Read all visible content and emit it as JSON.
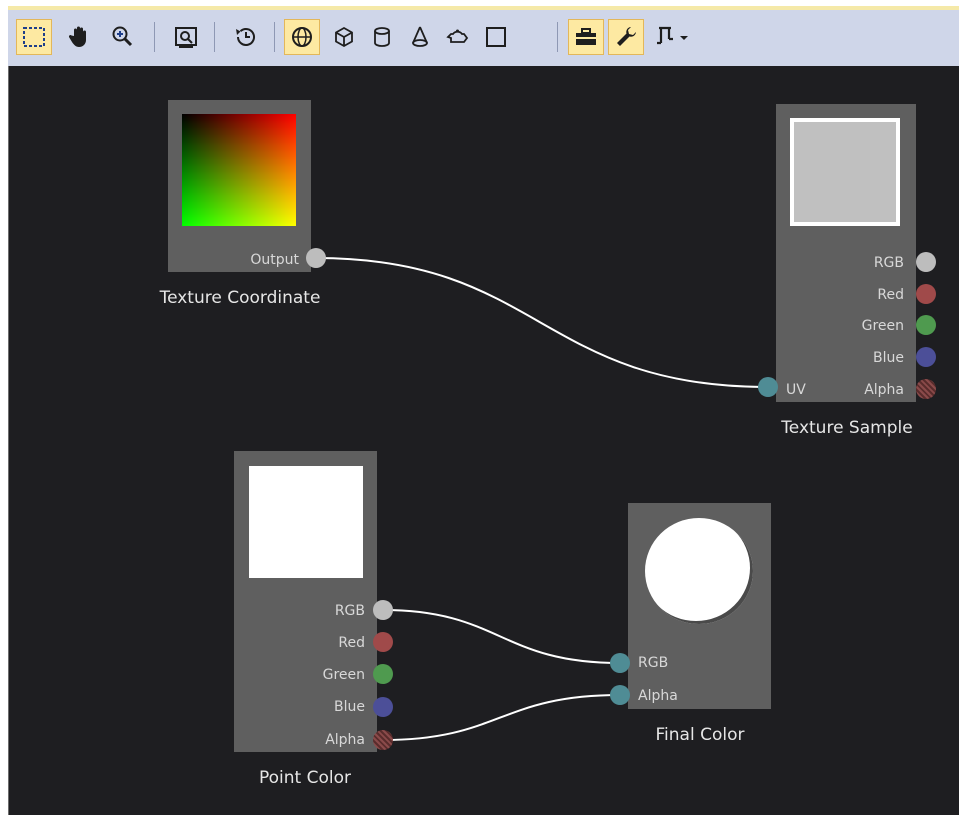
{
  "toolbar": {
    "buttons": [
      {
        "name": "select-tool-button",
        "icon": "dashed-rectangle-icon",
        "active": true
      },
      {
        "name": "pan-tool-button",
        "icon": "hand-icon",
        "active": false
      },
      {
        "name": "zoom-tool-button",
        "icon": "magnifier-plus-icon",
        "active": false
      },
      {
        "name": "zoom-to-fit-button",
        "icon": "zoom-fit-icon",
        "active": false
      },
      {
        "name": "real-time-mode-button",
        "icon": "clock-refresh-icon",
        "active": false
      },
      {
        "name": "sphere-preview-button",
        "icon": "sphere-icon",
        "active": true
      },
      {
        "name": "cube-preview-button",
        "icon": "cube-icon",
        "active": false
      },
      {
        "name": "cylinder-preview-button",
        "icon": "cylinder-icon",
        "active": false
      },
      {
        "name": "cone-preview-button",
        "icon": "cone-icon",
        "active": false
      },
      {
        "name": "teapot-preview-button",
        "icon": "teapot-icon",
        "active": false
      },
      {
        "name": "plane-preview-button",
        "icon": "square-icon",
        "active": false
      },
      {
        "name": "toolbox-button",
        "icon": "toolbox-icon",
        "active": true
      },
      {
        "name": "properties-button",
        "icon": "wrench-icon",
        "active": true
      },
      {
        "name": "advanced-menu-button",
        "icon": "advanced-dropdown-icon",
        "active": false
      }
    ]
  },
  "nodes": {
    "texture_coordinate": {
      "title": "Texture Coordinate",
      "outputs": [
        "Output"
      ]
    },
    "texture_sample": {
      "title": "Texture Sample",
      "outputs": [
        "RGB",
        "Red",
        "Green",
        "Blue",
        "Alpha"
      ],
      "inputs": [
        "UV"
      ]
    },
    "point_color": {
      "title": "Point Color",
      "outputs": [
        "RGB",
        "Red",
        "Green",
        "Blue",
        "Alpha"
      ]
    },
    "final_color": {
      "title": "Final Color",
      "inputs": [
        "RGB",
        "Alpha"
      ]
    }
  },
  "colors": {
    "canvas": "#1e1e21",
    "node": "#5f5f5f",
    "pin_rgb": "#bdbdbd",
    "pin_red": "#a04a4a",
    "pin_green": "#4f9a4f",
    "pin_blue": "#4c4f98",
    "pin_alpha": "#8a4a4a",
    "pin_input": "#4f8c95",
    "wire": "#ffffff"
  }
}
